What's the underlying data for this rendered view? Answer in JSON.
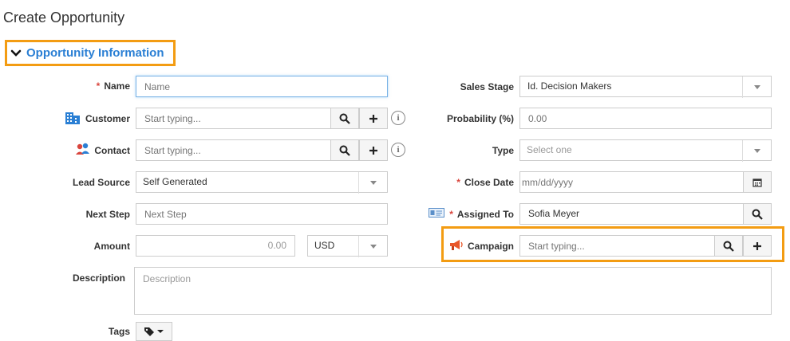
{
  "page": {
    "title": "Create Opportunity"
  },
  "section": {
    "title": "Opportunity Information"
  },
  "left": {
    "name": {
      "label": "Name",
      "required_mark": "*",
      "placeholder": "Name"
    },
    "customer": {
      "label": "Customer",
      "placeholder": "Start typing...",
      "info": "i"
    },
    "contact": {
      "label": "Contact",
      "placeholder": "Start typing...",
      "info": "i"
    },
    "lead_source": {
      "label": "Lead Source",
      "value": "Self Generated"
    },
    "next_step": {
      "label": "Next Step",
      "placeholder": "Next Step"
    },
    "amount": {
      "label": "Amount",
      "value": "0.00",
      "currency": "USD"
    }
  },
  "right": {
    "sales_stage": {
      "label": "Sales Stage",
      "value": "Id. Decision Makers"
    },
    "probability": {
      "label": "Probability (%)",
      "placeholder": "0.00"
    },
    "type": {
      "label": "Type",
      "placeholder": "Select one"
    },
    "close_date": {
      "label": "Close Date",
      "required_mark": "*",
      "placeholder": "mm/dd/yyyy"
    },
    "assigned_to": {
      "label": "Assigned To",
      "required_mark": "*",
      "value": "Sofia Meyer"
    },
    "campaign": {
      "label": "Campaign",
      "placeholder": "Start typing..."
    }
  },
  "description": {
    "label": "Description",
    "placeholder": "Description"
  },
  "tags": {
    "label": "Tags"
  },
  "colors": {
    "accent_border": "#f39c12",
    "link_blue": "#2a7fd4",
    "required_red": "#d9453d"
  }
}
